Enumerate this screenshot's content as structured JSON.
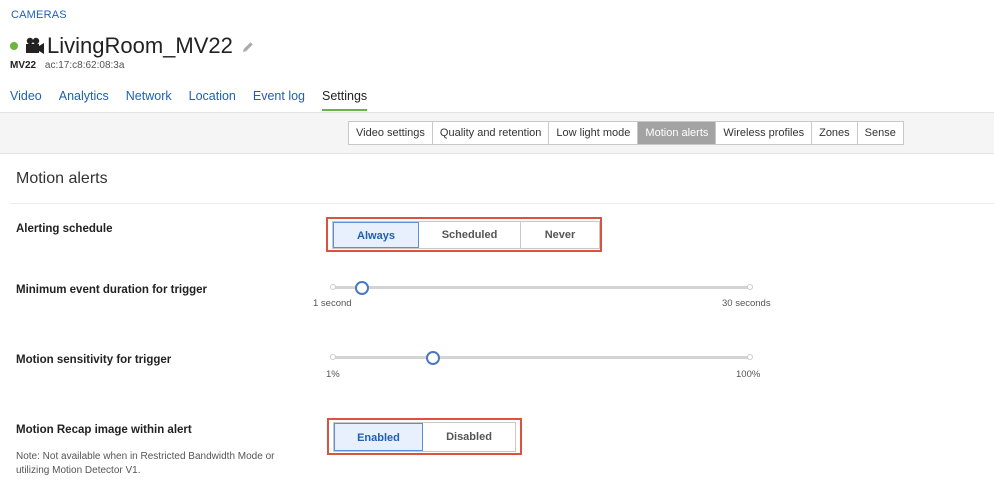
{
  "breadcrumb": "CAMERAS",
  "camera": {
    "name": "LivingRoom_MV22",
    "model": "MV22",
    "mac": "ac:17:c8:62:08:3a",
    "status_color": "#6bb43f"
  },
  "tabs": [
    {
      "label": "Video"
    },
    {
      "label": "Analytics"
    },
    {
      "label": "Network"
    },
    {
      "label": "Location"
    },
    {
      "label": "Event log"
    },
    {
      "label": "Settings",
      "active": true
    }
  ],
  "subtabs": [
    {
      "label": "Video settings"
    },
    {
      "label": "Quality and retention"
    },
    {
      "label": "Low light mode"
    },
    {
      "label": "Motion alerts",
      "active": true
    },
    {
      "label": "Wireless profiles"
    },
    {
      "label": "Zones"
    },
    {
      "label": "Sense"
    }
  ],
  "section_title": "Motion alerts",
  "alerting_schedule": {
    "label": "Alerting schedule",
    "options": [
      "Always",
      "Scheduled",
      "Never"
    ],
    "selected": "Always"
  },
  "min_duration": {
    "label": "Minimum event duration for trigger",
    "min_label": "1 second",
    "max_label": "30 seconds",
    "value_fraction": 0.07
  },
  "sensitivity": {
    "label": "Motion sensitivity for trigger",
    "min_label": "1%",
    "max_label": "100%",
    "value_fraction": 0.24
  },
  "recap": {
    "label": "Motion Recap image within alert",
    "options": [
      "Enabled",
      "Disabled"
    ],
    "selected": "Enabled",
    "note": "Note: Not available when in Restricted Bandwidth Mode or utilizing Motion Detector V1."
  },
  "colors": {
    "link": "#1f5fb5",
    "accent": "#6bb43f",
    "highlight": "#d9533f"
  },
  "icons": {
    "camera": "video-camera-icon",
    "edit": "pencil-icon"
  }
}
